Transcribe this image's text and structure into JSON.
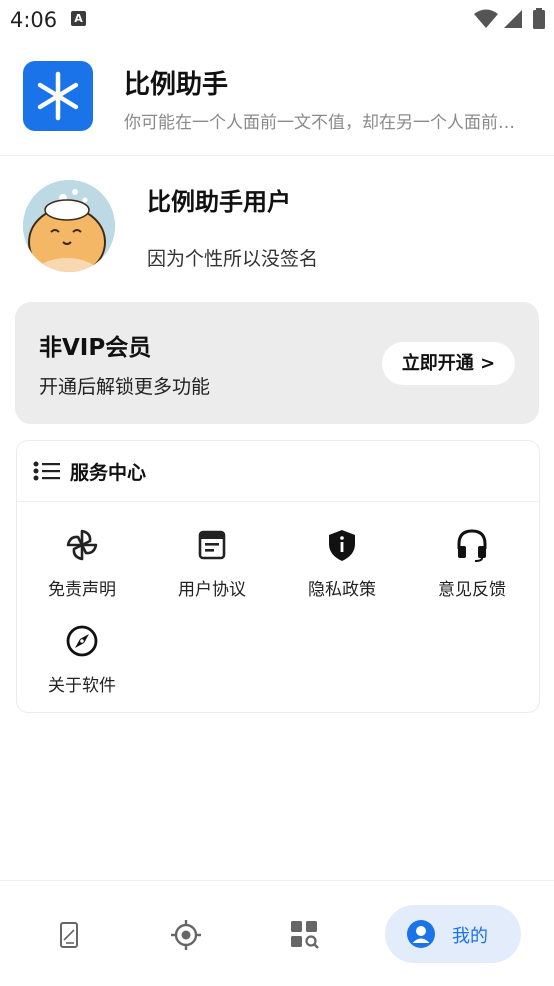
{
  "status_bar": {
    "time": "4:06",
    "notification_icon": "A"
  },
  "app": {
    "title": "比例助手",
    "subtitle": "你可能在一个人面前一文不值，却在另一个人面前是无价之宝",
    "logo_icon": "asterisk-icon",
    "brand_color": "#1a73e8"
  },
  "profile": {
    "name": "比例助手用户",
    "signature": "因为个性所以没签名"
  },
  "vip_card": {
    "title": "非VIP会员",
    "description": "开通后解锁更多功能",
    "button_label": "立即开通 >"
  },
  "service_center": {
    "title": "服务中心",
    "items": [
      {
        "label": "免责声明",
        "icon": "pinwheel-icon"
      },
      {
        "label": "用户协议",
        "icon": "document-icon"
      },
      {
        "label": "隐私政策",
        "icon": "shield-icon"
      },
      {
        "label": "意见反馈",
        "icon": "headset-icon"
      },
      {
        "label": "关于软件",
        "icon": "compass-icon"
      }
    ]
  },
  "bottom_nav": {
    "items": [
      {
        "icon": "phone-ruler-icon"
      },
      {
        "icon": "target-icon"
      },
      {
        "icon": "grid-search-icon"
      },
      {
        "icon": "user-icon",
        "label": "我的",
        "active": true
      }
    ]
  }
}
